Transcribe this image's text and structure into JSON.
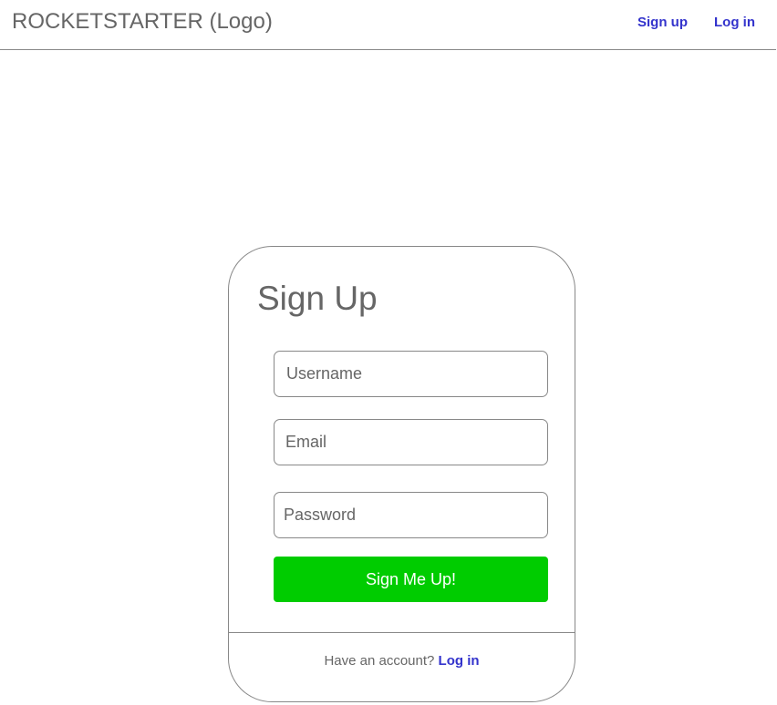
{
  "header": {
    "logo_text": "ROCKETSTARTER (Logo)",
    "nav": {
      "signup_label": "Sign up",
      "login_label": "Log in"
    }
  },
  "signup_form": {
    "title": "Sign Up",
    "username_placeholder": "Username",
    "email_placeholder": "Email",
    "password_placeholder": "Password",
    "submit_label": "Sign Me Up!",
    "footer_prompt": "Have an account?",
    "footer_link_label": "Log in"
  },
  "colors": {
    "link": "#3333cc",
    "submit_background": "#00cc00",
    "text": "#666666",
    "border": "#888888"
  }
}
